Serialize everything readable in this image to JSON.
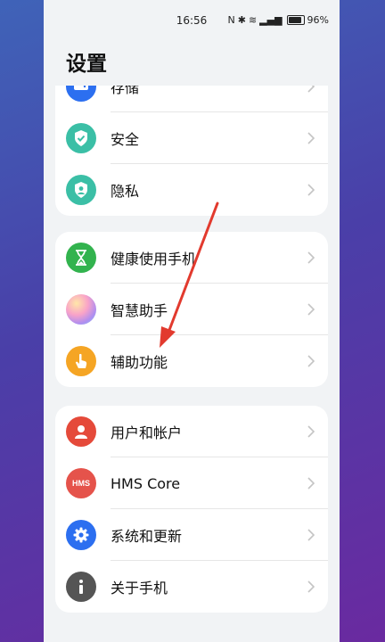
{
  "status_bar": {
    "time": "16:56",
    "battery": "96%"
  },
  "page_title": "设置",
  "sections": [
    {
      "items": [
        {
          "label": "存储",
          "icon": "storage-icon",
          "color": "#2c6ff0"
        },
        {
          "label": "安全",
          "icon": "shield-check-icon",
          "color": "#3bbfa6"
        },
        {
          "label": "隐私",
          "icon": "privacy-shield-icon",
          "color": "#3bbfa6"
        }
      ]
    },
    {
      "items": [
        {
          "label": "健康使用手机",
          "icon": "hourglass-icon",
          "color": "#32b34e"
        },
        {
          "label": "智慧助手",
          "icon": "assistant-orb-icon",
          "color": "#e89ac8"
        },
        {
          "label": "辅助功能",
          "icon": "hand-tap-icon",
          "color": "#f5a524"
        }
      ]
    },
    {
      "items": [
        {
          "label": "用户和帐户",
          "icon": "user-icon",
          "color": "#e54a3a"
        },
        {
          "label": "HMS Core",
          "icon": "hms-icon",
          "icon_text": "HMS",
          "color": "#e5534b"
        },
        {
          "label": "系统和更新",
          "icon": "gear-icon",
          "color": "#2c6ff0"
        },
        {
          "label": "关于手机",
          "icon": "info-icon",
          "color": "#555555"
        }
      ]
    }
  ]
}
